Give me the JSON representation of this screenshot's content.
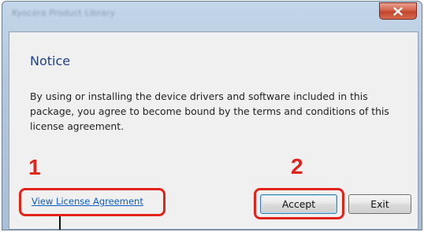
{
  "window": {
    "title": "Kyocera Product Library",
    "close_icon": "close-icon",
    "accent_colors": {
      "titlebar": "#b3c8de",
      "close_button": "#c1452c",
      "notice_title": "#1e3f8f",
      "link": "#0b5cc8",
      "callout": "#e2231a"
    }
  },
  "notice": {
    "title": "Notice",
    "body": "By using or installing the device drivers and software included in this package, you agree to become bound by the terms and conditions of this license agreement."
  },
  "links": {
    "view_license": "View License Agreement"
  },
  "buttons": {
    "accept": "Accept",
    "exit": "Exit"
  },
  "callouts": {
    "first": "1",
    "second": "2"
  }
}
